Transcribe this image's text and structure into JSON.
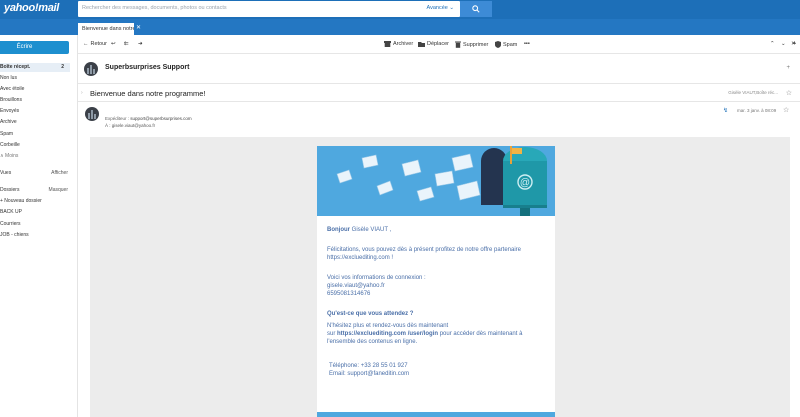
{
  "header": {
    "logo": "yahoo!mail",
    "search_placeholder": "Rechercher des messages, documents, photos ou contacts",
    "search_advanced": "Avancée"
  },
  "tabs": [
    {
      "label": "Bienvenue dans notre"
    }
  ],
  "sidebar": {
    "compose_label": "Écrire",
    "folders": [
      {
        "label": "Boîte récept.",
        "count": "2"
      },
      {
        "label": "Non lus"
      },
      {
        "label": "Avec étoile"
      },
      {
        "label": "Brouillons"
      },
      {
        "label": "Envoyés"
      },
      {
        "label": "Archive"
      },
      {
        "label": "Spam"
      },
      {
        "label": "Corbeille"
      },
      {
        "label": "∧ Moins"
      }
    ],
    "views_label": "Vues",
    "views_action": "Afficher",
    "folders_label": "Dossiers",
    "folders_action": "Masquer",
    "user_folders": [
      "+ Nouveau dossier",
      "BACK UP",
      "Courriers",
      "JOB - chiens"
    ]
  },
  "toolbar": {
    "back": "Retour",
    "archive": "Archiver",
    "move": "Déplacer",
    "delete": "Supprimer",
    "spam": "Spam",
    "more": "•••"
  },
  "message": {
    "sender_name": "Superbsurprises Support",
    "subject": "Bienvenue dans notre programme!",
    "subject_meta": "Gisèle VIAUT,Boîte réc...",
    "from_label": "Expéditeur :",
    "from_addr": "support@superbsurprises.com",
    "to_label": "À :",
    "to_addr": "gisele.viaut@yahoo.fr",
    "date": "mar. 3 janv. à 08:09"
  },
  "email_body": {
    "greeting_prefix": "Bonjour ",
    "greeting_name": "Gisèle VIAUT",
    "greeting_suffix": " ,",
    "intro": "Félicitations, vous pouvez dès à présent profitez de notre offre partenaire",
    "intro_link": "https://excluediting.com !",
    "creds_title": "Voici vos informations de connexion :",
    "creds_email": "gisele.viaut@yahoo.fr",
    "creds_code": "6595081314676",
    "question": "Qu'est-ce que vous attendez ?",
    "cta_line1": "N'hésitez plus et rendez-vous dès maintenant",
    "cta_prefix": "sur ",
    "cta_link": "https://excluediting.com /user/login",
    "cta_suffix": " pour accéder dès maintenant à l'ensemble des contenus en ligne.",
    "phone": "Téléphone: +33 28 55 01 927",
    "email": "Email: support@faneditin.com"
  },
  "colors": {
    "brand": "#1d6fb8",
    "accent": "#1d8fcf",
    "banner": "#4fa8df",
    "body_text": "#4a6fa8"
  }
}
